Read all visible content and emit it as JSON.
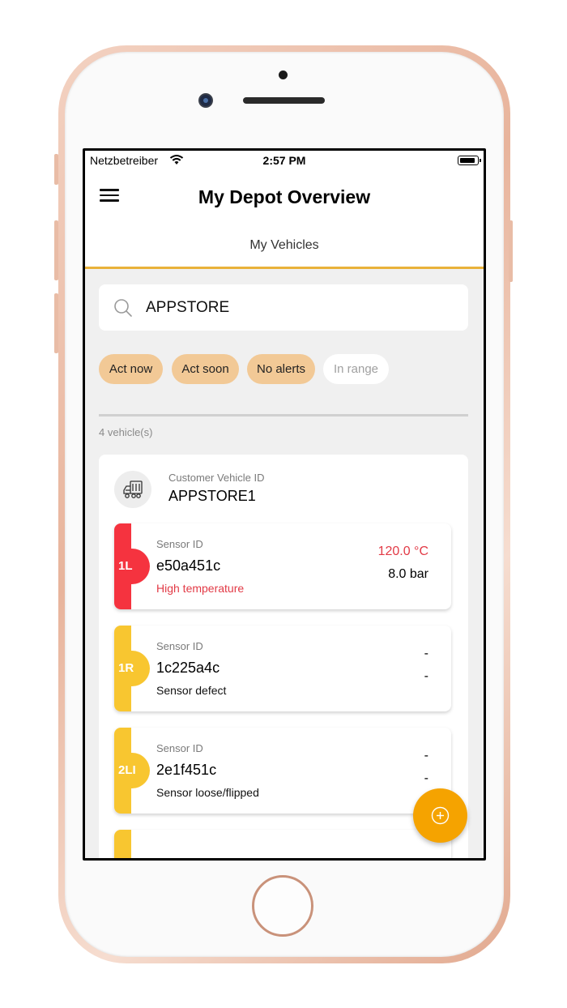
{
  "status_bar": {
    "carrier": "Netzbetreiber",
    "time": "2:57 PM"
  },
  "nav": {
    "title": "My Depot Overview"
  },
  "tabs": [
    {
      "label": "My Vehicles"
    }
  ],
  "search": {
    "value": "APPSTORE"
  },
  "filters": [
    {
      "label": "Act now",
      "state": "active"
    },
    {
      "label": "Act soon",
      "state": "active"
    },
    {
      "label": "No alerts",
      "state": "active"
    },
    {
      "label": "In range",
      "state": "inactive"
    }
  ],
  "vehicle_count": "4 vehicle(s)",
  "vehicle": {
    "id_label": "Customer Vehicle ID",
    "id_value": "APPSTORE1",
    "sensors": [
      {
        "position": "1L",
        "label": "Sensor ID",
        "id": "e50a451c",
        "status": "High temperature",
        "temperature": "120.0 °C",
        "pressure": "8.0 bar",
        "color": "#f5333f",
        "status_color": "#e23a46"
      },
      {
        "position": "1R",
        "label": "Sensor ID",
        "id": "1c225a4c",
        "status": "Sensor defect",
        "temperature": "-",
        "pressure": "-",
        "color": "#f8c630",
        "status_color": "#111111"
      },
      {
        "position": "2LI",
        "label": "Sensor ID",
        "id": "2e1f451c",
        "status": "Sensor loose/flipped",
        "temperature": "-",
        "pressure": "-",
        "color": "#f8c630",
        "status_color": "#111111"
      }
    ]
  },
  "colors": {
    "accent": "#f5a300",
    "tab_underline": "#e9b23a",
    "chip_active": "#f2c996",
    "alert_red": "#f5333f",
    "warn_yellow": "#f8c630"
  },
  "icons": {
    "menu": "hamburger-icon",
    "search": "search-icon",
    "wifi": "wifi-icon",
    "battery": "battery-icon",
    "vehicle": "truck-icon",
    "fab": "add-icon"
  }
}
